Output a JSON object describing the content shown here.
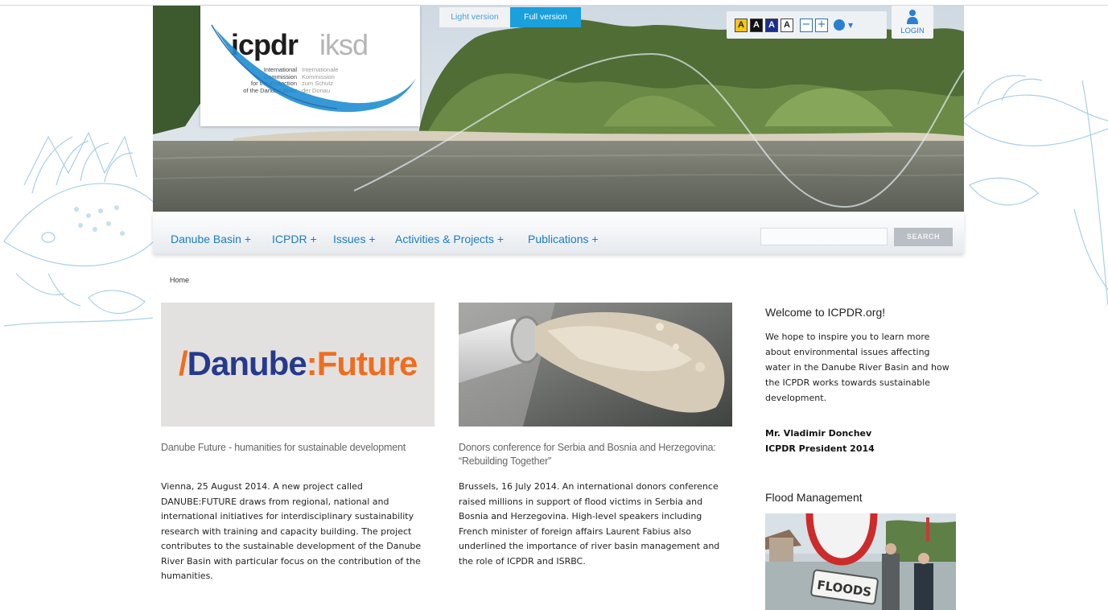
{
  "header": {
    "logo": {
      "main": "icpdr",
      "alt": "iksd",
      "sub_en": "International\nCommission\nfor the Protection\nof the Danube River",
      "sub_de": "Internationale\nKommission\nzum Schutz\nder Donau"
    },
    "version_light": "Light version",
    "version_full": "Full version",
    "accessibility": {
      "contrast_labels": [
        "A",
        "A",
        "A",
        "A"
      ],
      "zoom_out": "−",
      "zoom_in": "+"
    },
    "login_label": "LOGIN"
  },
  "nav": {
    "items": [
      "Danube Basin +",
      "ICPDR +",
      "Issues +",
      "Activities & Projects +",
      "Publications +"
    ],
    "search_placeholder": "",
    "search_button": "SEARCH"
  },
  "breadcrumb": "Home",
  "articles": [
    {
      "image_text": {
        "mark": "/",
        "part1": "Danube",
        "sep": ":",
        "part2": "Future"
      },
      "title": "Danube Future - humanities for sustainable development",
      "text": "Vienna, 25 August 2014. A new project called DANUBE:FUTURE draws from regional, national and international initiatives for interdisciplinary sustainability research with training and capacity building. The project contributes to the sustainable development of the Danube River Basin with particular focus on the contribution of the humanities."
    },
    {
      "title": "Donors conference for Serbia and Bosnia and Herzegovina: “Rebuilding Together”",
      "text": "Brussels, 16 July 2014. An international donors conference raised millions in support of flood victims in Serbia and Bosnia and Herzegovina. High-level speakers including French minister of foreign affairs Laurent Fabius also underlined the importance of river basin management and the role of ICPDR and ISRBC."
    }
  ],
  "sidebar": {
    "welcome_heading": "Welcome to ICPDR.org!",
    "welcome_text": "We hope to inspire you to learn more about environmental issues affecting water in the Danube River Basin and how the ICPDR works towards sustainable development.",
    "signature_name": "Mr. Vladimir Donchev",
    "signature_role": "ICPDR President 2014",
    "flood_heading": "Flood Management",
    "flood_sign": "FLOODS"
  },
  "colors": {
    "link_blue": "#1e7bc4",
    "accent_orange": "#f06d1f",
    "navy": "#253a8c",
    "full_version_bg": "#1aa0dc"
  }
}
